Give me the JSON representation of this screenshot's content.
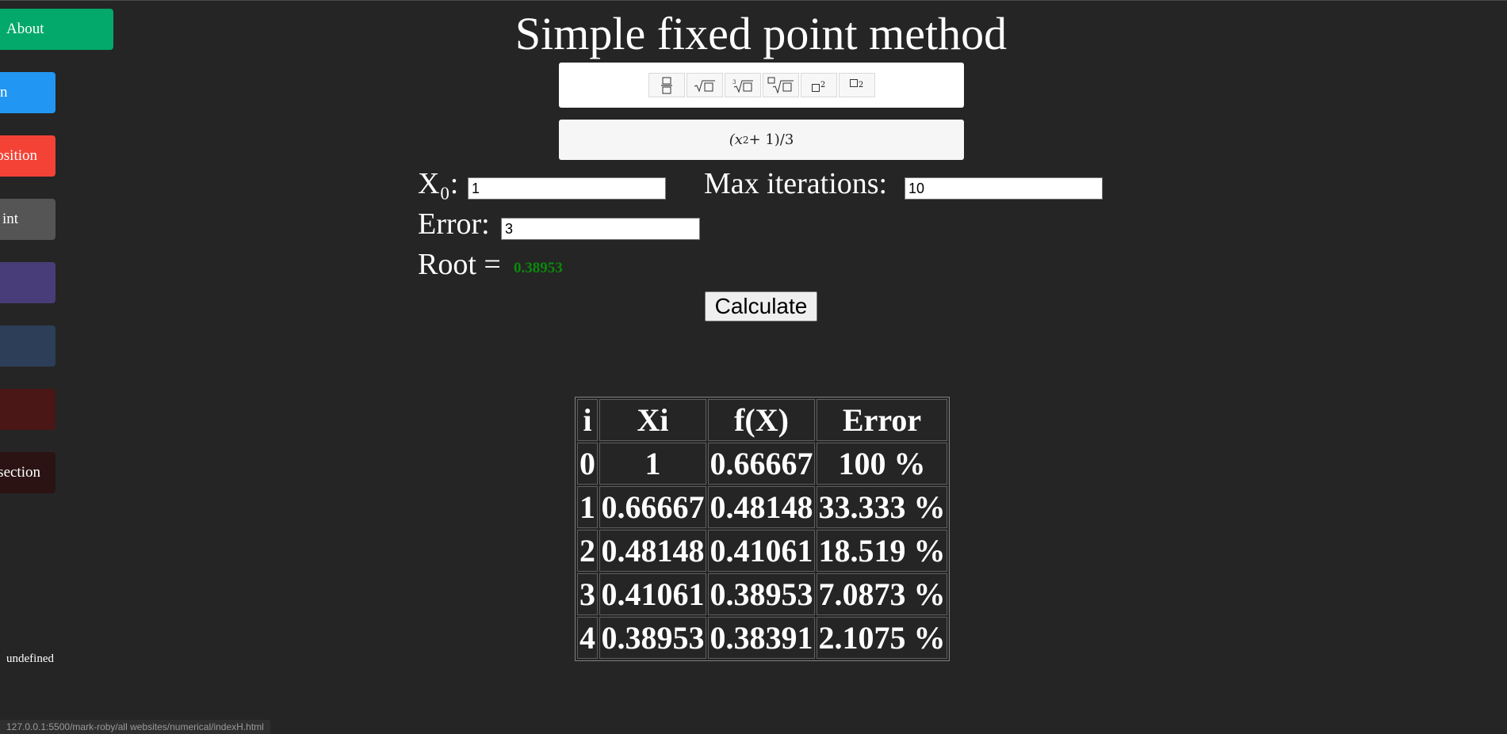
{
  "sidebar": {
    "items": [
      {
        "label": "About",
        "color": "#03a96a"
      },
      {
        "label": "n",
        "color": "#2196f3"
      },
      {
        "label": "position",
        "color": "#f44336"
      },
      {
        "label": "int",
        "color": "#555555"
      },
      {
        "label": "",
        "color": "#483d78"
      },
      {
        "label": "",
        "color": "#2c3e58"
      },
      {
        "label": "",
        "color": "#4a1616"
      },
      {
        "label": "section",
        "color": "#2b1313"
      }
    ],
    "footer_text": "undefined"
  },
  "page": {
    "title": "Simple fixed point method"
  },
  "toolbar": {
    "buttons": [
      {
        "icon": "fraction-icon"
      },
      {
        "icon": "square-root-icon"
      },
      {
        "icon": "cube-root-icon"
      },
      {
        "icon": "nth-root-icon"
      },
      {
        "icon": "superscript-icon",
        "sup": "2"
      },
      {
        "icon": "subscript-icon",
        "sub": "2"
      }
    ]
  },
  "formula": {
    "base": "(x",
    "exp": "2",
    "rest": " + 1)/3"
  },
  "form": {
    "x0_label": "X₀:",
    "x0_value": "1",
    "max_iter_label": "Max iterations:",
    "max_iter_value": "10",
    "error_label": "Error:",
    "error_value": "3",
    "root_label": "Root =",
    "root_value": "0.38953",
    "root_color": "#0a8a0a",
    "calculate_label": "Calculate"
  },
  "results": {
    "headers": [
      "i",
      "Xi",
      "f(X)",
      "Error"
    ],
    "rows": [
      [
        "0",
        "1",
        "0.66667",
        "100 %"
      ],
      [
        "1",
        "0.66667",
        "0.48148",
        "33.333 %"
      ],
      [
        "2",
        "0.48148",
        "0.41061",
        "18.519 %"
      ],
      [
        "3",
        "0.41061",
        "0.38953",
        "7.0873 %"
      ],
      [
        "4",
        "0.38953",
        "0.38391",
        "2.1075 %"
      ]
    ]
  },
  "status_bar": {
    "url": "127.0.0.1:5500/mark-roby/all websites/numerical/indexH.html"
  }
}
